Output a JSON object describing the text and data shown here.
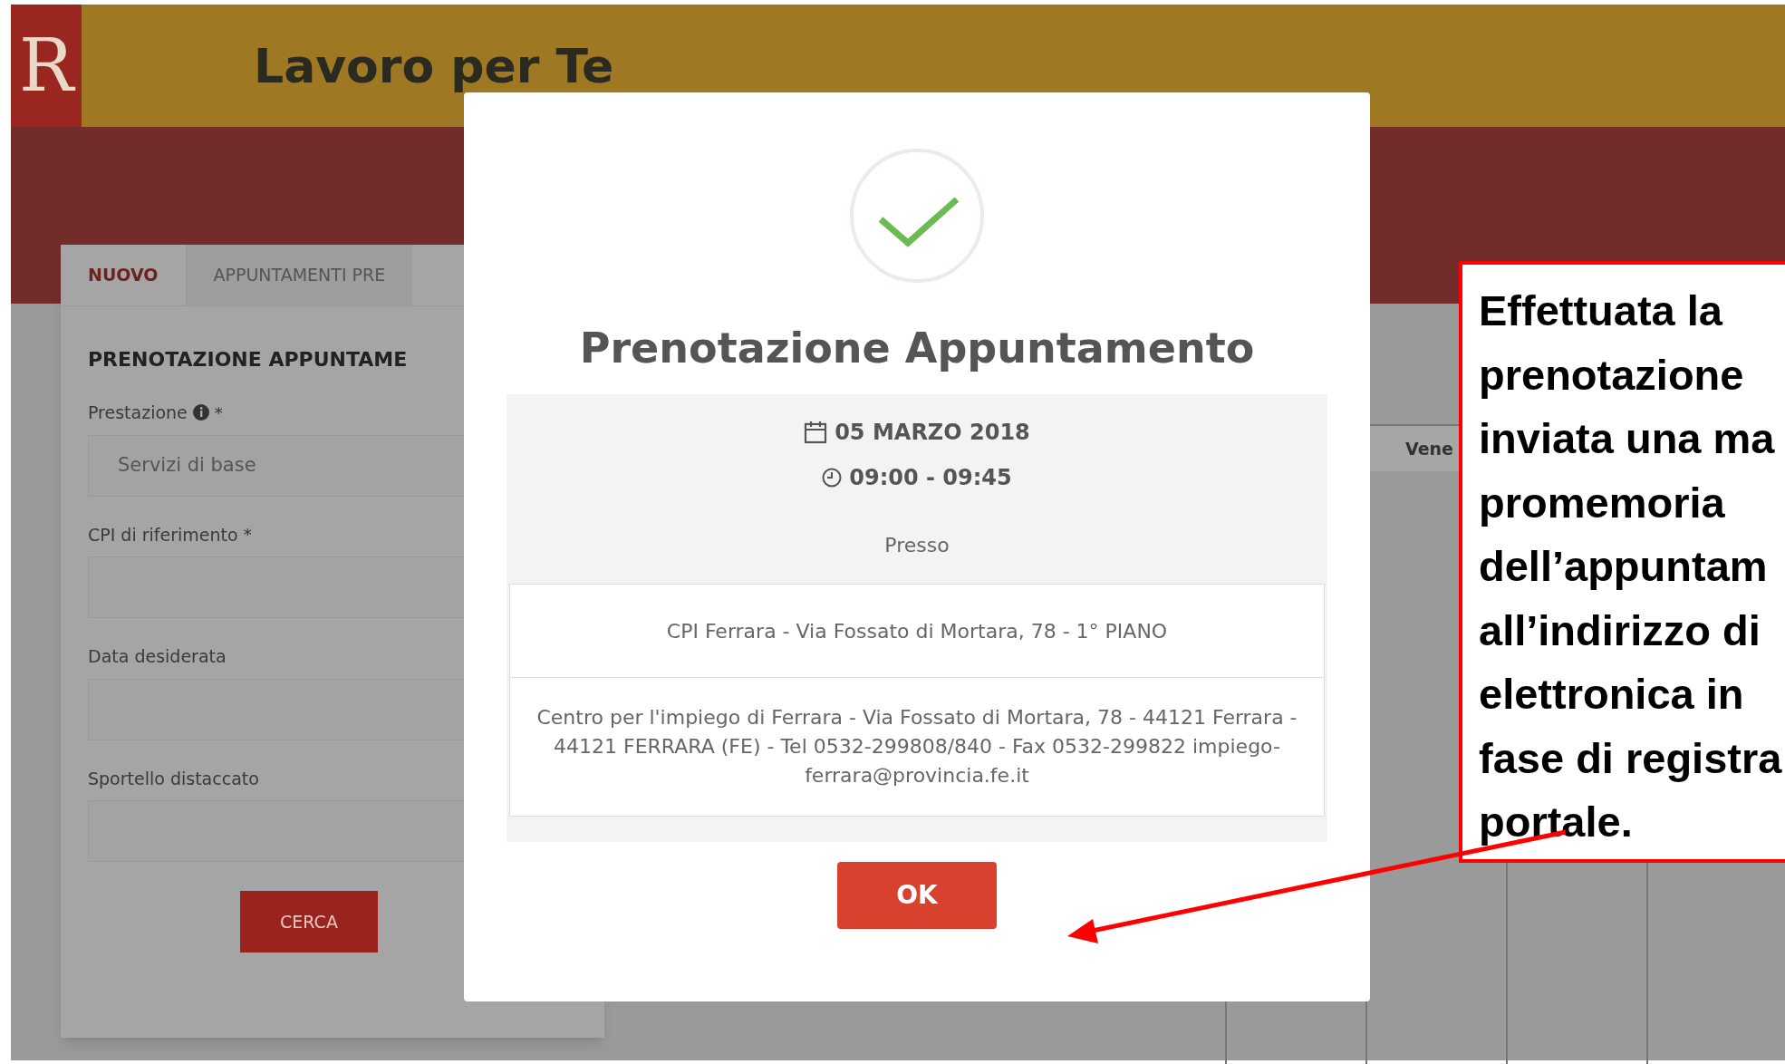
{
  "header": {
    "logo_letter": "R",
    "title": "Lavoro per Te"
  },
  "tabs": [
    {
      "label": "NUOVO",
      "selected": true
    },
    {
      "label": "APPUNTAMENTI PRE",
      "selected": false
    }
  ],
  "form": {
    "title": "PRENOTAZIONE APPUNTAME",
    "fields": [
      {
        "label": "Prestazione",
        "info": true,
        "mark": "*",
        "value": "Servizi di base"
      },
      {
        "label": "CPI di riferimento",
        "info": false,
        "mark": "*"
      },
      {
        "label": "Data desiderata",
        "info": false
      },
      {
        "label": "Sportello distaccato",
        "info": false
      }
    ],
    "button": "CERCA"
  },
  "calendar": {
    "column_header": "Vene"
  },
  "modal": {
    "title": "Prenotazione Appuntamento",
    "date": "05 MARZO 2018",
    "time": "09:00 - 09:45",
    "at_label": "Presso",
    "place": "CPI Ferrara - Via Fossato di Mortara, 78 - 1° PIANO",
    "address": "Centro per l'impiego di Ferrara - Via Fossato di Mortara, 78 - 44121 Ferrara - 44121 FERRARA (FE) - Tel 0532-299808/840 - Fax 0532-299822 impiego-ferrara@provincia.fe.it",
    "button": "OK"
  },
  "callout": {
    "lines": [
      "Effettuata la",
      "prenotazione",
      "inviata una ma",
      "promemoria",
      "dell’appuntam",
      "all’indirizzo di",
      "elettronica in",
      "fase di registra",
      "portale."
    ]
  }
}
